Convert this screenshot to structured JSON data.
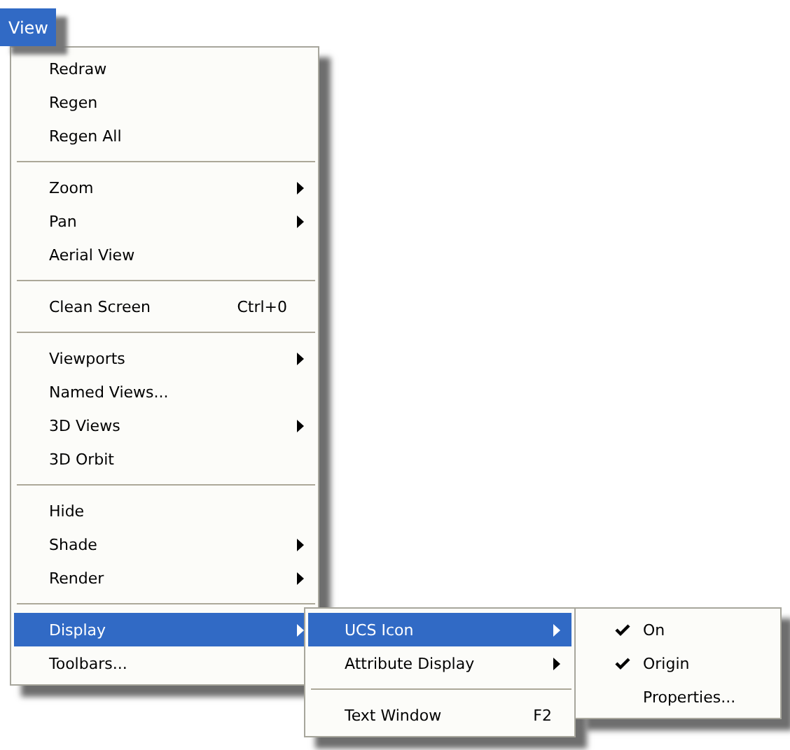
{
  "menu_bar": [
    {
      "label": "View",
      "selected": true
    }
  ],
  "menu": {
    "items": [
      {
        "kind": "item",
        "label": "Redraw"
      },
      {
        "kind": "item",
        "label": "Regen"
      },
      {
        "kind": "item",
        "label": "Regen All"
      },
      {
        "kind": "separator"
      },
      {
        "kind": "item",
        "label": "Zoom",
        "has_submenu": true
      },
      {
        "kind": "item",
        "label": "Pan",
        "has_submenu": true
      },
      {
        "kind": "item",
        "label": "Aerial View"
      },
      {
        "kind": "separator"
      },
      {
        "kind": "item",
        "label": "Clean Screen",
        "shortcut": "Ctrl+0"
      },
      {
        "kind": "separator"
      },
      {
        "kind": "item",
        "label": "Viewports",
        "has_submenu": true
      },
      {
        "kind": "item",
        "label": "Named Views..."
      },
      {
        "kind": "item",
        "label": "3D Views",
        "has_submenu": true
      },
      {
        "kind": "item",
        "label": "3D Orbit"
      },
      {
        "kind": "separator"
      },
      {
        "kind": "item",
        "label": "Hide"
      },
      {
        "kind": "item",
        "label": "Shade",
        "has_submenu": true
      },
      {
        "kind": "item",
        "label": "Render",
        "has_submenu": true
      },
      {
        "kind": "separator"
      },
      {
        "kind": "item",
        "label": "Display",
        "has_submenu": true,
        "selected": true,
        "children": [
          {
            "kind": "item",
            "label": "UCS Icon",
            "has_submenu": true,
            "selected": true,
            "children": [
              {
                "kind": "check",
                "label": "On",
                "checked": true
              },
              {
                "kind": "check",
                "label": "Origin",
                "checked": true
              },
              {
                "kind": "check",
                "label": "Properties...",
                "checked": false
              }
            ]
          },
          {
            "kind": "item",
            "label": "Attribute Display",
            "has_submenu": true,
            "selected": false
          },
          {
            "kind": "separator"
          },
          {
            "kind": "item",
            "label": "Text Window",
            "shortcut": "F2",
            "selected": false
          }
        ]
      },
      {
        "kind": "item",
        "label": "Toolbars...",
        "selected": false
      }
    ]
  }
}
